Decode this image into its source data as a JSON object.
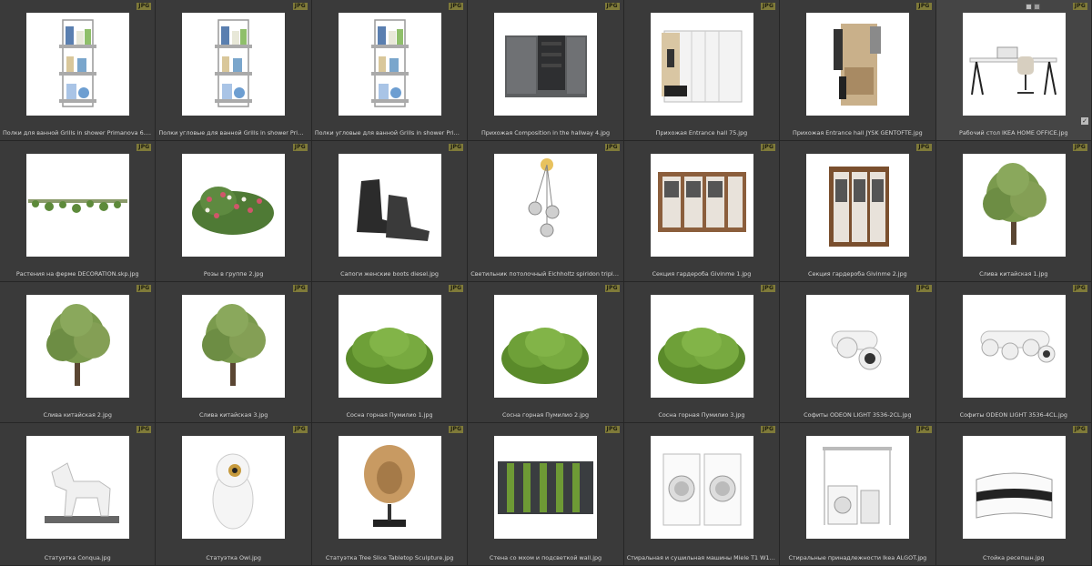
{
  "badge_label": "JPG",
  "colors": {
    "background": "#262626",
    "cell": "#3a3a3a",
    "badge": "#7f7a39",
    "caption_text": "#d6d6d6"
  },
  "items": [
    {
      "filename": "Полки для ванной Grills in shower Primanova 6.jpg",
      "thumb": "bath-shelf"
    },
    {
      "filename": "Полки угловые для ванной Grills in shower Primanova 1.jpg",
      "thumb": "bath-shelf"
    },
    {
      "filename": "Полки угловые для ванной Grills in shower Primanova 2.jpg",
      "thumb": "bath-shelf"
    },
    {
      "filename": "Прихожая Composition in the hallway 4.jpg",
      "thumb": "cabinet"
    },
    {
      "filename": "Прихожая Entrance hall 75.jpg",
      "thumb": "wardrobe"
    },
    {
      "filename": "Прихожая Entrance hall JYSK GENTOFTE.jpg",
      "thumb": "hall-stand"
    },
    {
      "filename": "Рабочий стол IKEA HOME OFFICE.jpg",
      "thumb": "desk",
      "selected": true
    },
    {
      "filename": "Растения на ферме DECORATION.skp.jpg",
      "thumb": "vine"
    },
    {
      "filename": "Розы в группе 2.jpg",
      "thumb": "roses"
    },
    {
      "filename": "Сапоги женские boots diesel.jpg",
      "thumb": "boots"
    },
    {
      "filename": "Светильник потолочный Eichholtz spiridon triple.jpg",
      "thumb": "pendant"
    },
    {
      "filename": "Секция гардероба Givinme 1.jpg",
      "thumb": "closet"
    },
    {
      "filename": "Секция гардероба Givinme 2.jpg",
      "thumb": "closet2"
    },
    {
      "filename": "Слива китайская 1.jpg",
      "thumb": "tree"
    },
    {
      "filename": "Слива китайская 2.jpg",
      "thumb": "tree"
    },
    {
      "filename": "Слива китайская 3.jpg",
      "thumb": "tree"
    },
    {
      "filename": "Сосна горная Пумилио 1.jpg",
      "thumb": "shrub"
    },
    {
      "filename": "Сосна горная Пумилио 2.jpg",
      "thumb": "shrub"
    },
    {
      "filename": "Сосна горная Пумилио 3.jpg",
      "thumb": "shrub"
    },
    {
      "filename": "Софиты ODEON LIGHT 3536-2CL.jpg",
      "thumb": "spot2"
    },
    {
      "filename": "Софиты ODEON LIGHT 3536-4CL.jpg",
      "thumb": "spot4"
    },
    {
      "filename": "Статуэтка Conqua.jpg",
      "thumb": "horse"
    },
    {
      "filename": "Статуэтка Owl.jpg",
      "thumb": "owl"
    },
    {
      "filename": "Статуэтка Tree Slice Tabletop Sculpture.jpg",
      "thumb": "sculpture"
    },
    {
      "filename": "Стена со мхом и подсветкой wall.jpg",
      "thumb": "mosswall"
    },
    {
      "filename": "Стиральная и сушильная машины Miele T1 W1.jpg",
      "thumb": "washer"
    },
    {
      "filename": "Стиральные принадлежности Ikea ALGOT.jpg",
      "thumb": "laundry"
    },
    {
      "filename": "Стойка ресепшн.jpg",
      "thumb": "reception"
    }
  ],
  "selected_item_icons": [
    "thumbnail-view-icon",
    "edit-pen-icon",
    "checkbox-checked-icon"
  ]
}
